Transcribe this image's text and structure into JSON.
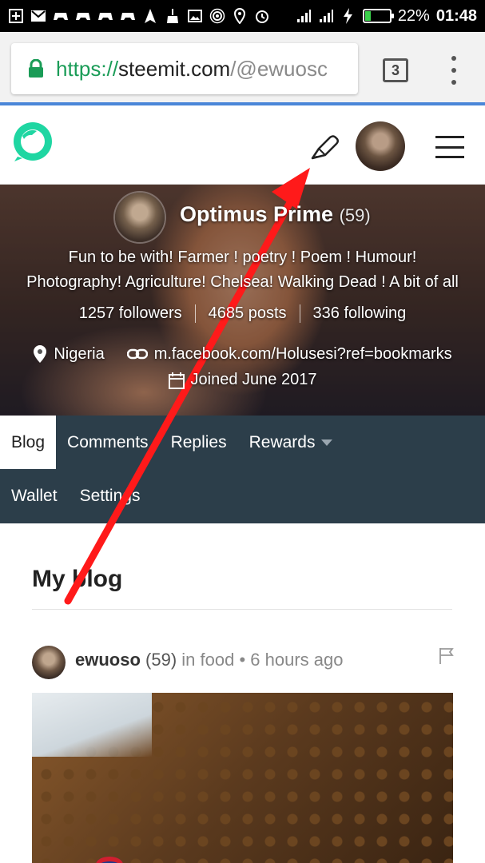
{
  "status_bar": {
    "battery_percent": "22%",
    "battery_level": 0.22,
    "time": "01:48"
  },
  "browser": {
    "url_scheme": "https://",
    "url_host": "steemit.com",
    "url_path": "/@ewuosc",
    "tab_count": "3"
  },
  "profile": {
    "name": "Optimus Prime",
    "reputation": "(59)",
    "bio_line1": "Fun to be with! Farmer ! poetry ! Poem ! Humour!",
    "bio_line2": "Photography! Agriculture! Chelsea! Walking Dead ! A bit of all",
    "followers": "1257 followers",
    "posts": "4685 posts",
    "following": "336 following",
    "location": "Nigeria",
    "website": "m.facebook.com/Holusesi?ref=bookmarks",
    "joined": "Joined June 2017"
  },
  "nav": {
    "blog": "Blog",
    "comments": "Comments",
    "replies": "Replies",
    "rewards": "Rewards",
    "wallet": "Wallet",
    "settings": "Settings"
  },
  "blog": {
    "title": "My blog"
  },
  "post": {
    "author": "ewuoso",
    "reputation": "(59)",
    "category_text": "in food",
    "separator": "•",
    "time": "6 hours ago"
  },
  "colors": {
    "steem_green": "#1fd6a2",
    "nav_bg": "#2c3e4a",
    "annotation_arrow": "#ff1a1a"
  },
  "icons": [
    "lock-icon",
    "steem-logo-icon",
    "pen-icon",
    "hamburger-icon",
    "location-pin-icon",
    "link-icon",
    "calendar-icon",
    "flag-icon",
    "kebab-menu-icon"
  ]
}
